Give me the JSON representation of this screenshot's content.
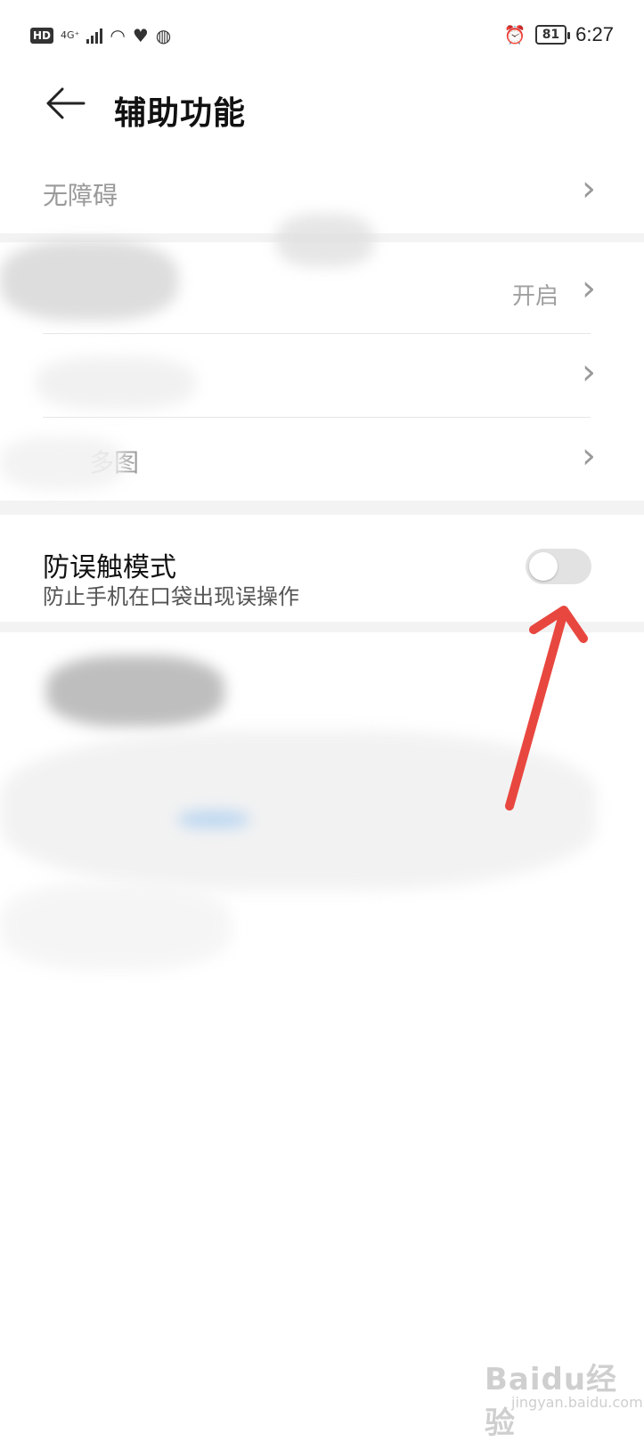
{
  "status_bar": {
    "hd": "HD",
    "network": "4G⁺",
    "battery": "81",
    "time": "6:27"
  },
  "header": {
    "title": "辅助功能",
    "back_icon": "back-arrow-icon"
  },
  "rows": [
    {
      "label": "无障碍"
    },
    {
      "label": "",
      "value": "开启"
    },
    {
      "label": ""
    },
    {
      "label": "多图"
    }
  ],
  "feature": {
    "title": "防误触模式",
    "subtitle": "防止手机在口袋出现误操作",
    "toggle_on": false
  },
  "watermark": {
    "main": "Baidu经验",
    "sub": "jingyan.baidu.com"
  },
  "colors": {
    "arrow": "#e8473f",
    "toggle_off": "#e2e2e2"
  }
}
